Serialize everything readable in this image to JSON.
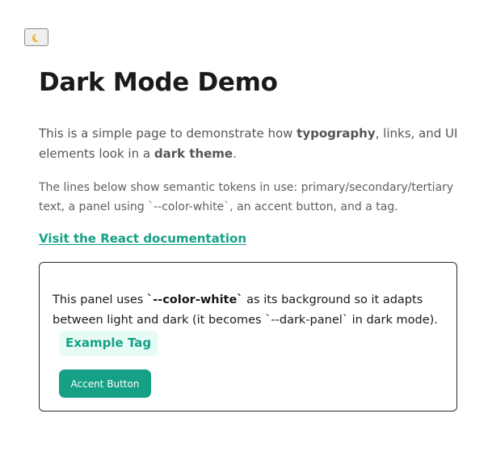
{
  "toggle": {
    "icon": "moon-icon"
  },
  "title": "Dark Mode Demo",
  "intro": {
    "pre": "This is a simple page to demonstrate how ",
    "bold1": "typography",
    "mid": ", links, and UI elements look in a ",
    "bold2": "dark theme",
    "post": "."
  },
  "tokens_text": "The lines below show semantic tokens in use: primary/secondary/tertiary text, a panel using `--color-white`, an accent button, and a tag.",
  "link": {
    "label": "Visit the React documentation"
  },
  "panel": {
    "pre": "This panel uses ",
    "bold": "`--color-white`",
    "post": " as its background so it adapts between light and dark (it becomes `--dark-panel` in dark mode).",
    "tag_label": "Example Tag",
    "button_label": "Accent Button"
  },
  "colors": {
    "accent": "#16a085",
    "tag_background": "#e7fbf5",
    "text_primary": "#1a1a1a",
    "text_secondary": "#555555"
  }
}
